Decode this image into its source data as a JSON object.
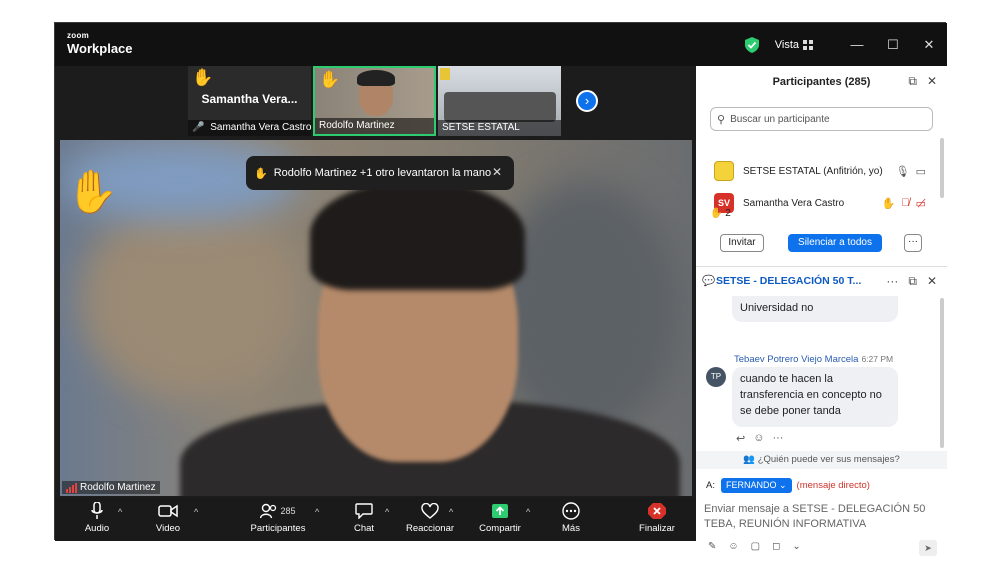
{
  "app": {
    "brand_top": "zoom",
    "brand_bottom": "Workplace",
    "view_label": "Vista"
  },
  "window_controls": {
    "minimize": "—",
    "maximize": "☐",
    "close": "✕"
  },
  "strip": {
    "tiles": [
      {
        "name": "Samantha Vera Castro",
        "big": "Samantha  Vera...",
        "hand": "✋",
        "muted": true
      },
      {
        "name": "Rodolfo Martinez",
        "hand": "✋",
        "active": true
      },
      {
        "name": "SETSE ESTATAL"
      }
    ]
  },
  "video": {
    "toast": "Rodolfo Martinez +1 otro levantaron la mano",
    "speaker_name": "Rodolfo Martinez"
  },
  "toolbar": {
    "audio": "Audio",
    "video": "Video",
    "participants": "Participantes",
    "participants_count": "285",
    "chat": "Chat",
    "react": "Reaccionar",
    "share": "Compartir",
    "more": "Más",
    "end": "Finalizar"
  },
  "participants_panel": {
    "title": "Participantes (285)",
    "search_placeholder": "Buscar un participante",
    "rows": [
      {
        "initials": "",
        "name": "SETSE ESTATAL (Anfitrión, yo)",
        "color": "#f3d23a"
      },
      {
        "initials": "SV",
        "name": "Samantha Vera Castro",
        "color": "#d6322a"
      }
    ],
    "raised_hands": "2",
    "invite": "Invitar",
    "mute_all": "Silenciar a todos",
    "more": "···"
  },
  "chat_panel": {
    "title": "SETSE - DELEGACIÓN 50 T...",
    "messages": [
      {
        "text": "Universidad no"
      },
      {
        "sender": "Tebaev Potrero Viejo Marcela",
        "time": "6:27 PM",
        "initials": "TP",
        "text": "cuando te hacen la transferencia en concepto no se debe poner tanda"
      }
    ],
    "who_can_see": "¿Quién puede ver sus mensajes?",
    "to_label": "A:",
    "recipient": "FERNANDO",
    "direct": "(mensaje directo)",
    "compose_placeholder": "Enviar mensaje a SETSE - DELEGACIÓN 50 TEBA, REUNIÓN INFORMATIVA"
  },
  "colors": {
    "accent": "#0e72ed",
    "host_green": "#2ecc71",
    "danger": "#d6322a"
  }
}
